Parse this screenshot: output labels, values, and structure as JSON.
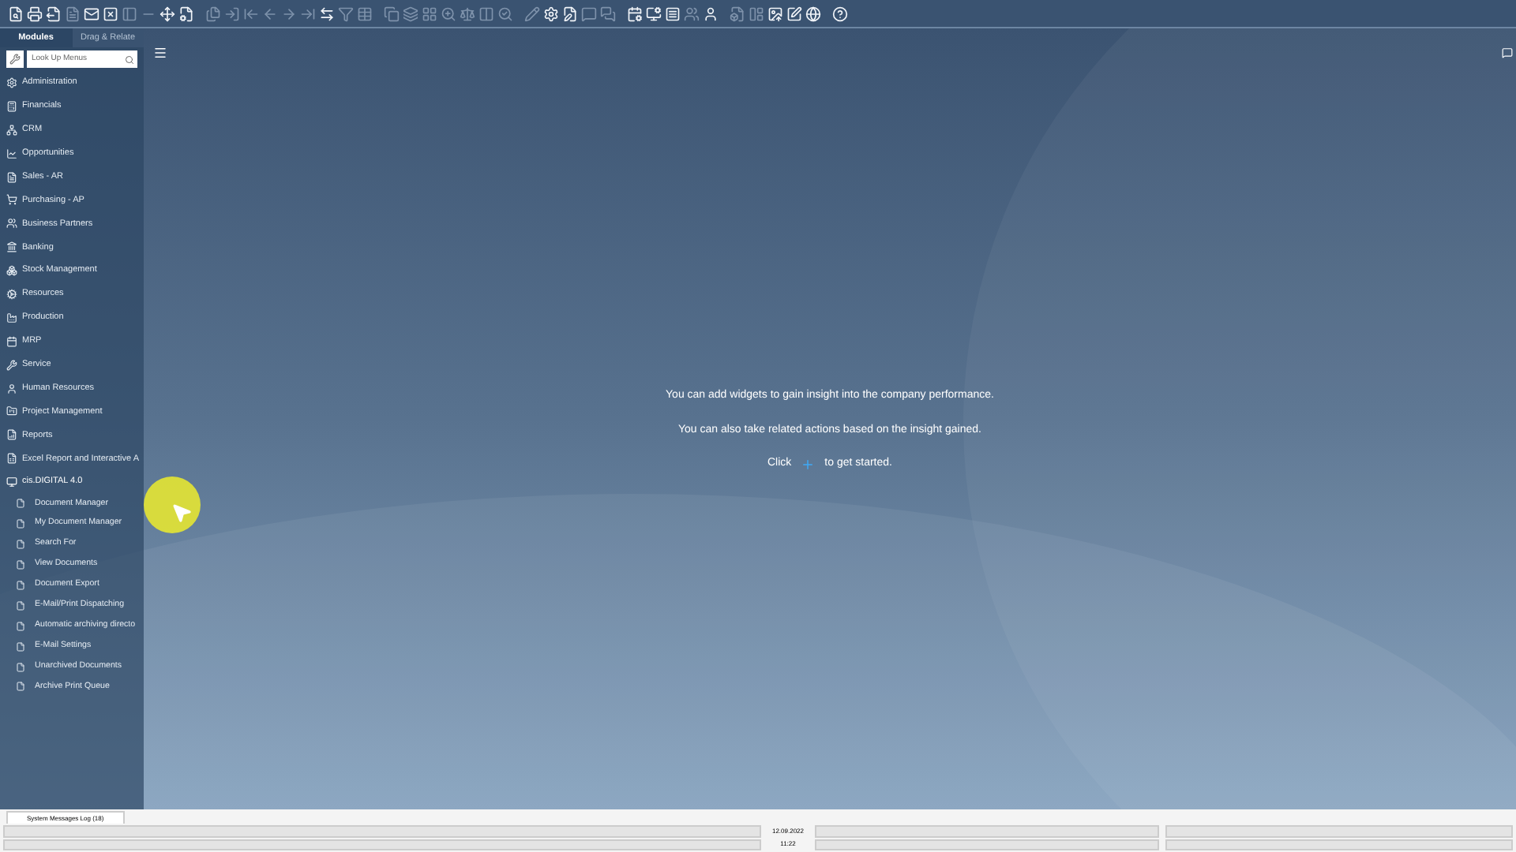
{
  "toolbar": [
    {
      "disabled": false
    },
    {
      "disabled": false
    },
    {
      "disabled": false
    },
    {
      "disabled": true
    },
    {
      "disabled": false
    },
    {
      "disabled": false
    },
    {
      "disabled": true
    },
    {
      "disabled": true
    },
    {
      "disabled": false
    },
    {
      "disabled": false
    },
    {
      "disabled": true
    },
    {
      "disabled": true
    },
    {
      "disabled": true
    },
    {
      "disabled": true
    },
    {
      "disabled": true
    },
    {
      "disabled": true
    },
    {
      "disabled": false
    },
    {
      "disabled": true
    },
    {
      "disabled": true
    },
    {
      "disabled": true
    },
    {
      "disabled": true
    },
    {
      "disabled": true
    },
    {
      "disabled": true
    },
    {
      "disabled": true
    },
    {
      "disabled": true
    },
    {
      "disabled": true
    },
    {
      "disabled": true
    },
    {
      "disabled": false
    },
    {
      "disabled": false
    },
    {
      "disabled": true
    },
    {
      "disabled": true
    },
    {
      "disabled": false
    },
    {
      "disabled": false
    },
    {
      "disabled": false
    },
    {
      "disabled": true
    },
    {
      "disabled": false
    },
    {
      "disabled": true
    },
    {
      "disabled": true
    },
    {
      "disabled": false
    },
    {
      "disabled": false
    },
    {
      "disabled": false
    },
    {
      "disabled": false
    }
  ],
  "sidebar": {
    "tabs": [
      {
        "label": "Modules",
        "selected": true
      },
      {
        "label": "Drag & Relate",
        "selected": false
      }
    ],
    "search": {
      "placeholder": "Look Up Menus"
    },
    "items": [
      {
        "label": "Administration",
        "expanded": false
      },
      {
        "label": "Financials",
        "expanded": false
      },
      {
        "label": "CRM",
        "expanded": false
      },
      {
        "label": "Opportunities",
        "expanded": false
      },
      {
        "label": "Sales - AR",
        "expanded": false
      },
      {
        "label": "Purchasing - AP",
        "expanded": false
      },
      {
        "label": "Business Partners",
        "expanded": false
      },
      {
        "label": "Banking",
        "expanded": false
      },
      {
        "label": "Stock Management",
        "expanded": false
      },
      {
        "label": "Resources",
        "expanded": false
      },
      {
        "label": "Production",
        "expanded": false
      },
      {
        "label": "MRP",
        "expanded": false
      },
      {
        "label": "Service",
        "expanded": false
      },
      {
        "label": "Human Resources",
        "expanded": false
      },
      {
        "label": "Project Management",
        "expanded": false
      },
      {
        "label": "Reports",
        "expanded": false
      },
      {
        "label": "Excel Report and Interactive A",
        "expanded": false
      },
      {
        "label": "cis.DIGITAL 4.0",
        "expanded": true,
        "children": [
          {
            "label": "Document Manager"
          },
          {
            "label": "My Document Manager"
          },
          {
            "label": "Search For"
          },
          {
            "label": "View Documents"
          },
          {
            "label": "Document Export"
          },
          {
            "label": "E-Mail/Print Dispatching"
          },
          {
            "label": "Automatic archiving directo"
          },
          {
            "label": "E-Mail Settings"
          },
          {
            "label": "Unarchived Documents"
          },
          {
            "label": "Archive Print Queue"
          }
        ]
      }
    ]
  },
  "main": {
    "lines": [
      "You can add widgets to gain insight into the company performance.",
      "You can also take related actions based on the insight gained."
    ],
    "click_before": "Click",
    "click_after": "to get started."
  },
  "status_bar": {
    "tab": "System Messages Log (18)",
    "date": "12.09.2022",
    "time": "11:22"
  }
}
